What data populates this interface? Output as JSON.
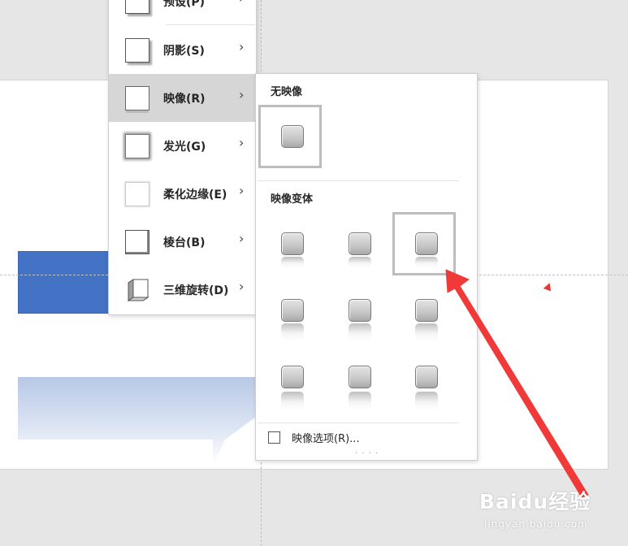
{
  "menu": {
    "items": [
      {
        "label": "预设(P)",
        "icon": "preset-icon"
      },
      {
        "label": "阴影(S)",
        "icon": "shadow-icon"
      },
      {
        "label": "映像(R)",
        "icon": "reflection-icon",
        "active": true
      },
      {
        "label": "发光(G)",
        "icon": "glow-icon"
      },
      {
        "label": "柔化边缘(E)",
        "icon": "soft-edges-icon"
      },
      {
        "label": "棱台(B)",
        "icon": "bevel-icon"
      },
      {
        "label": "三维旋转(D)",
        "icon": "3d-rotation-icon"
      }
    ],
    "chevron": "›"
  },
  "gallery": {
    "no_reflection_header": "无映像",
    "variations_header": "映像变体",
    "options_label": "映像选项(R)...",
    "grip": "· · · ·",
    "selected_variation": "row 1, column 3"
  },
  "watermark": {
    "brand": "Baidu经验",
    "sub": "jingyan.baidu.com"
  },
  "colors": {
    "accent_shape": "#4472c4",
    "annotation_arrow": "#f03a3a",
    "menu_active_bg": "#d6d6d6"
  }
}
